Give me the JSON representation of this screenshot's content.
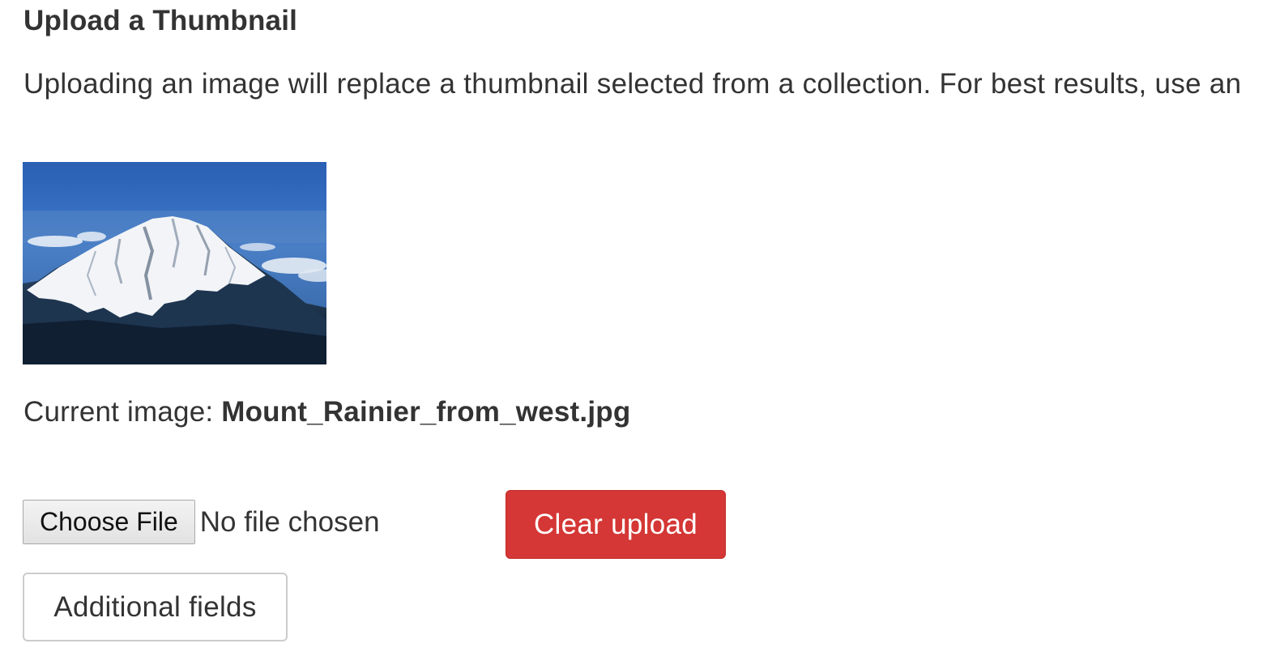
{
  "section": {
    "title": "Upload a Thumbnail",
    "description": "Uploading an image will replace a thumbnail selected from a collection. For best results, use an"
  },
  "thumbnail": {
    "icon": "mountain-image",
    "sky_color": "#2f66b8",
    "snow_color": "#f2f4f7"
  },
  "current_image": {
    "label": "Current image: ",
    "filename": "Mount_Rainier_from_west.jpg"
  },
  "file_input": {
    "button_label": "Choose File",
    "status": "No file chosen"
  },
  "clear_button": {
    "label": "Clear upload",
    "color": "#d43735"
  },
  "additional_button": {
    "label": "Additional fields"
  }
}
